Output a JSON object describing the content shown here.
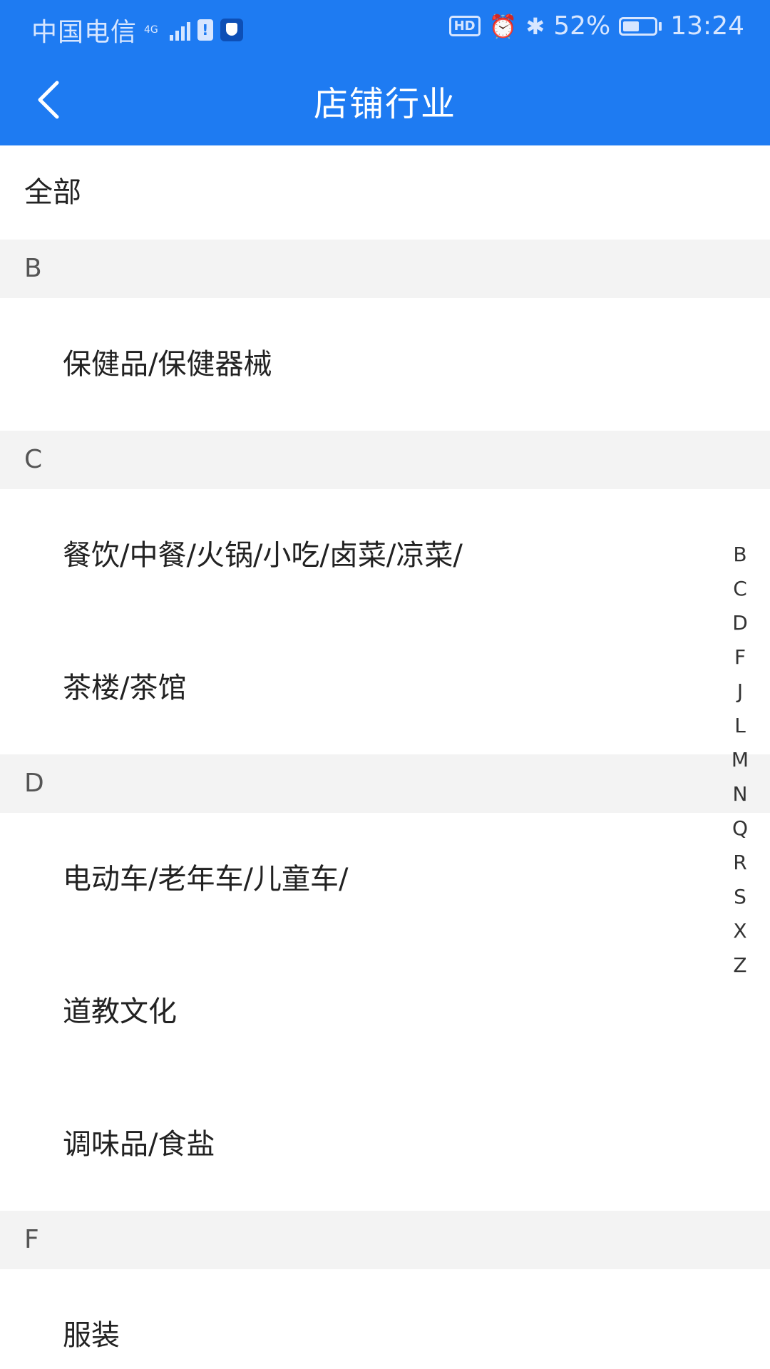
{
  "status_bar": {
    "carrier": "中国电信",
    "network": "4G",
    "bluetooth_glyph": "✱",
    "hd_label": "HD",
    "battery_percent": "52%",
    "battery_level": 0.52,
    "time": "13:24",
    "icons": [
      "signal-icon",
      "sim-alert-icon",
      "shield-icon",
      "hd-icon",
      "alarm-icon",
      "bluetooth-icon",
      "battery-icon"
    ]
  },
  "header": {
    "title": "店铺行业",
    "back_icon": "chevron-left-icon",
    "background_color": "#1e7bf2"
  },
  "list": {
    "all_label": "全部",
    "sections": [
      {
        "letter": "B",
        "items": [
          "保健品/保健器械"
        ]
      },
      {
        "letter": "C",
        "items": [
          "餐饮/中餐/火锅/小吃/卤菜/凉菜/",
          "茶楼/茶馆"
        ]
      },
      {
        "letter": "D",
        "items": [
          "电动车/老年车/儿童车/",
          "道教文化",
          "调味品/食盐"
        ]
      },
      {
        "letter": "F",
        "items": [
          "服装"
        ]
      }
    ]
  },
  "index_bar": {
    "letters": [
      "B",
      "C",
      "D",
      "F",
      "J",
      "L",
      "M",
      "N",
      "Q",
      "R",
      "S",
      "X",
      "Z"
    ]
  }
}
